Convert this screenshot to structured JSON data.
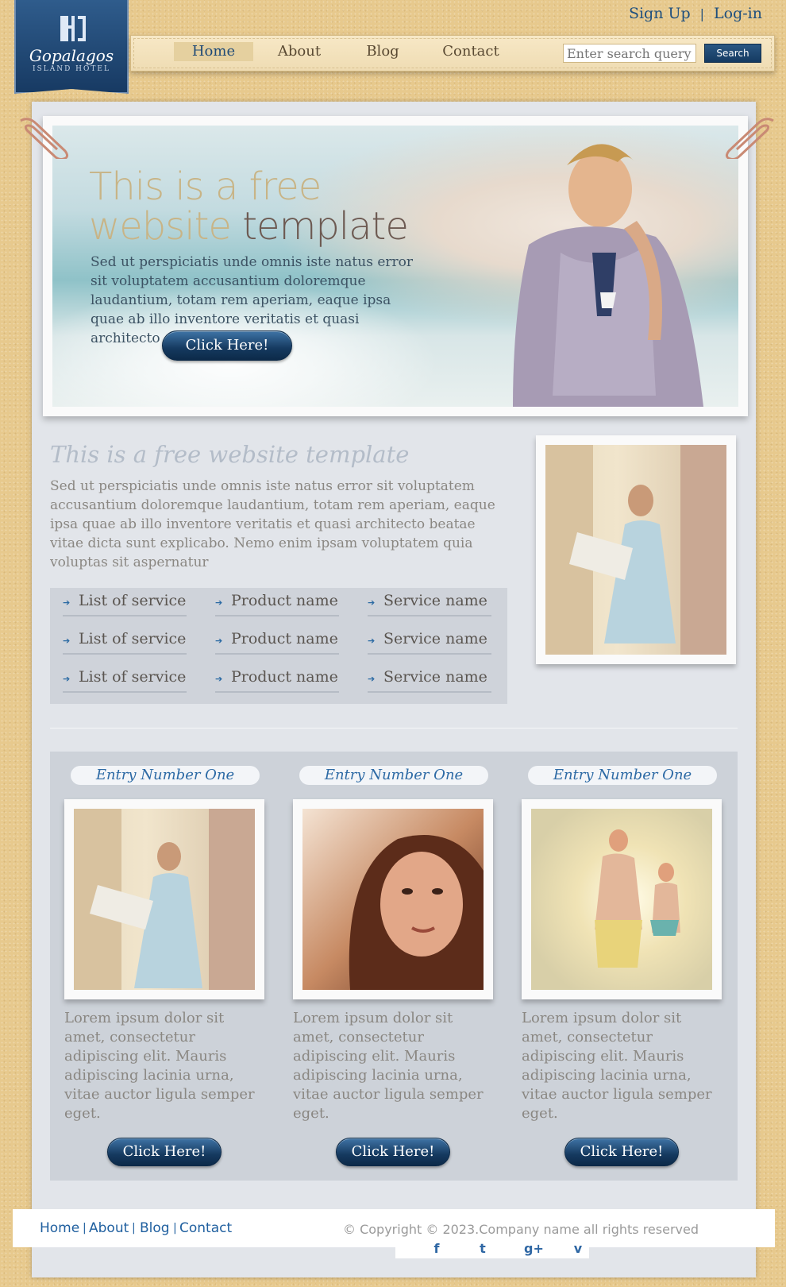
{
  "brand": {
    "name": "Gopalagos",
    "subtitle": "ISLAND HOTEL"
  },
  "auth": {
    "signup": "Sign Up",
    "separator": "|",
    "login": "Log-in"
  },
  "nav": {
    "items": [
      "Home",
      "About",
      "Blog",
      "Contact"
    ],
    "active": "Home"
  },
  "search": {
    "placeholder": "Enter search query",
    "button": "Search"
  },
  "hero": {
    "title_part1": "This is a free",
    "title_part2": "website",
    "title_part3": "template",
    "text": "Sed ut perspiciatis unde omnis iste natus error sit voluptatem accusantium doloremque laudantium, totam rem aperiam, eaque ipsa quae ab illo inventore veritatis et quasi architecto",
    "button": "Click Here!"
  },
  "intro": {
    "title": "This is a free website template",
    "text": "Sed ut perspiciatis unde omnis iste natus error sit voluptatem accusantium doloremque laudantium, totam rem aperiam, eaque ipsa quae ab illo inventore veritatis et quasi architecto beatae vitae dicta sunt explicabo. Nemo enim ipsam voluptatem quia voluptas sit aspernatur"
  },
  "services": {
    "columns": [
      [
        "List of service",
        "List of service",
        "List of service"
      ],
      [
        "Product name",
        "Product name",
        "Product name"
      ],
      [
        "Service name",
        "Service name",
        "Service name"
      ]
    ]
  },
  "entries": [
    {
      "title": "Entry Number One",
      "text": "Lorem ipsum dolor sit amet, consectetur adipiscing elit. Mauris adipiscing lacinia urna, vitae auctor ligula semper eget.",
      "button": "Click Here!"
    },
    {
      "title": "Entry Number One",
      "text": "Lorem ipsum dolor sit amet, consectetur adipiscing elit. Mauris adipiscing lacinia urna, vitae auctor ligula semper eget.",
      "button": "Click Here!"
    },
    {
      "title": "Entry Number One",
      "text": "Lorem ipsum dolor sit amet, consectetur adipiscing elit. Mauris adipiscing lacinia urna, vitae auctor ligula semper eget.",
      "button": "Click Here!"
    }
  ],
  "footer": {
    "links": [
      "Home",
      "About",
      "Blog",
      "Contact"
    ],
    "separator": "|",
    "copyright": "© Copyright © 2023.Company name all rights reserved"
  },
  "social": [
    {
      "icon": "facebook-icon",
      "glyph": "f"
    },
    {
      "icon": "twitter-icon",
      "glyph": "t"
    },
    {
      "icon": "google-plus-icon",
      "glyph": "g+"
    },
    {
      "icon": "vimeo-icon",
      "glyph": "v"
    }
  ],
  "colors": {
    "accent": "#1f4a76",
    "background": "#e7c98d",
    "panel": "#e2e5ea",
    "link": "#2d6aa5"
  }
}
